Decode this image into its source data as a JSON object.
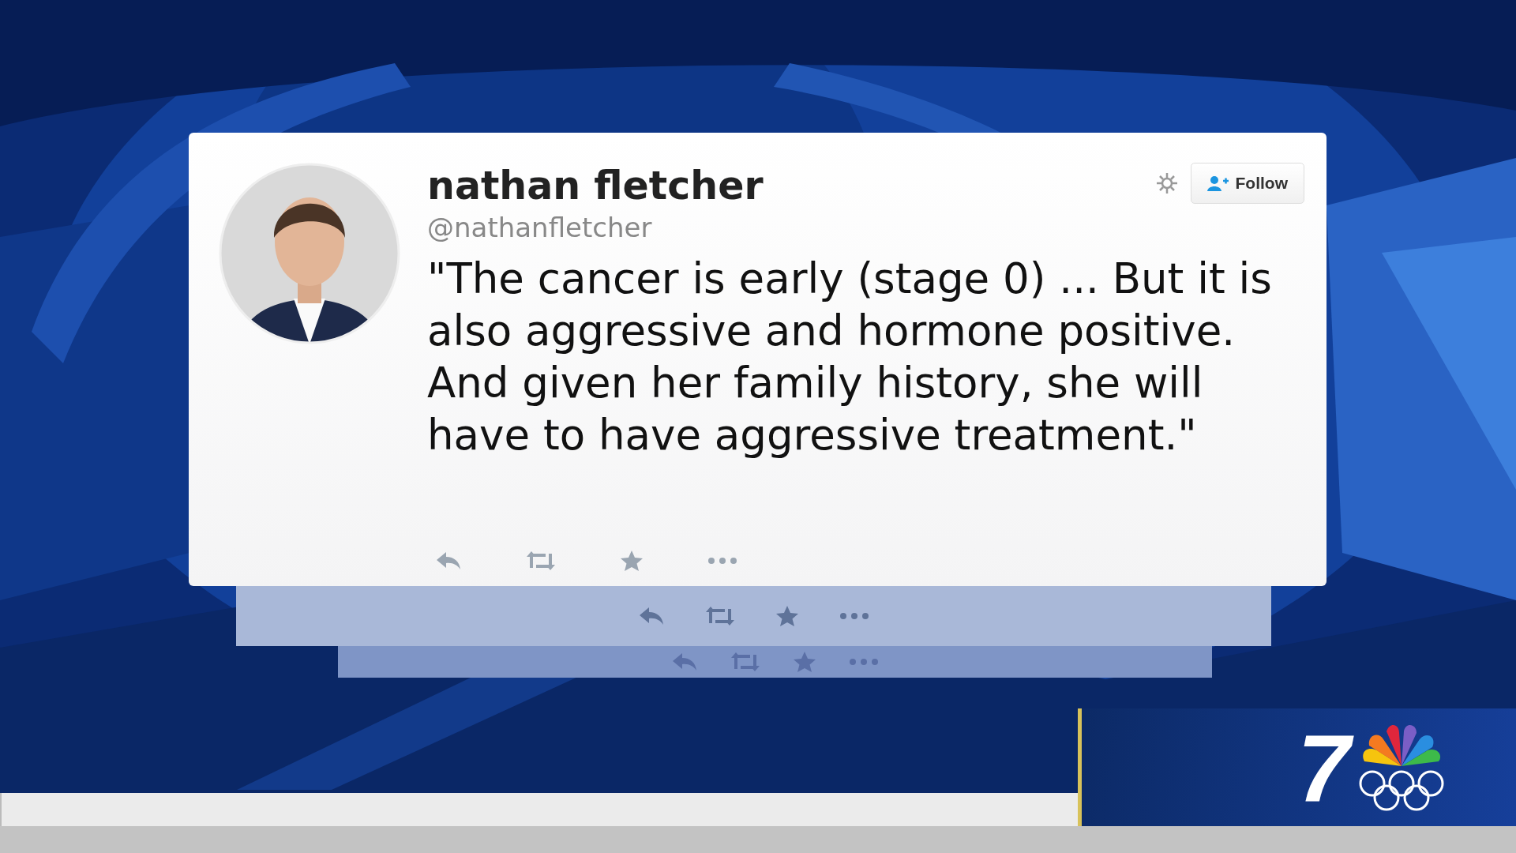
{
  "tweet": {
    "name": "nathan fletcher",
    "handle": "@nathanfletcher",
    "text": "\"The cancer is early (stage 0) ... But it is also aggressive and hormone positive. And given her family history, she will have to have aggressive treatment.\"",
    "follow_button": "Follow",
    "actions": [
      {
        "kind": "reply"
      },
      {
        "kind": "retweet"
      },
      {
        "kind": "favorite"
      },
      {
        "kind": "more"
      }
    ]
  },
  "station_logo": {
    "channel": "7"
  }
}
